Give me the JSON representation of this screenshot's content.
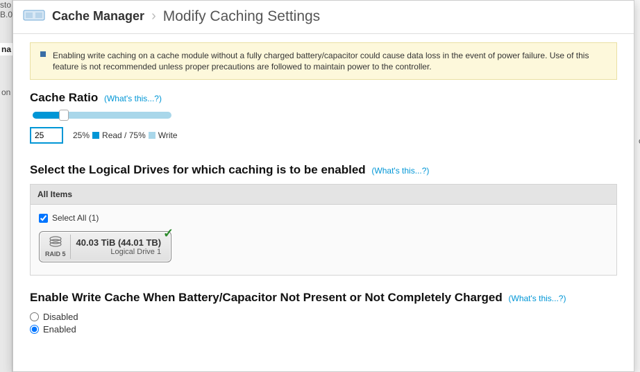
{
  "sidebar_scraps": {
    "s1": "sto",
    "s2": "B.0",
    "s3": "na",
    "s4": "on",
    "s5": "c"
  },
  "header": {
    "crumb1": "Cache Manager",
    "crumb2": "Modify Caching Settings"
  },
  "warning": "Enabling write caching on a cache module without a fully charged battery/capacitor could cause data loss in the event of power failure. Use of this feature is not recommended unless proper precautions are followed to maintain power to the controller.",
  "cache_ratio": {
    "title": "Cache Ratio",
    "whats": "(What's this...?)",
    "input_value": "25",
    "percent_text": "25%",
    "read_label": "Read / 75%",
    "write_label": "Write"
  },
  "drives_section": {
    "title": "Select the Logical Drives for which caching is to be enabled",
    "whats": "(What's this...?)",
    "panel_head": "All Items",
    "select_all": "Select All (1)",
    "card": {
      "raid": "RAID 5",
      "size": "40.03 TiB (44.01 TB)",
      "name": "Logical Drive 1",
      "checked": true
    }
  },
  "write_cache": {
    "title": "Enable Write Cache When Battery/Capacitor Not Present or Not Completely Charged",
    "whats": "(What's this...?)",
    "disabled": "Disabled",
    "enabled": "Enabled",
    "selected": "enabled"
  }
}
